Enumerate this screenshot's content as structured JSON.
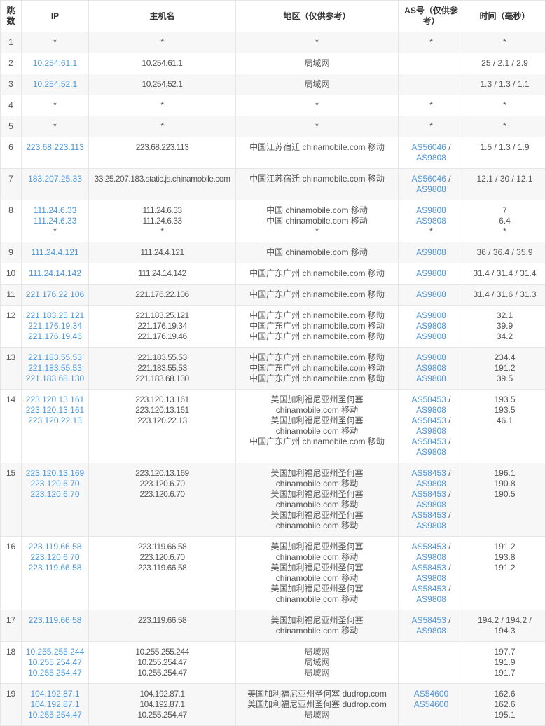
{
  "colors": {
    "link": "#4e96d8",
    "stripe": "#f7f7f7",
    "border": "#e6e6e6",
    "text": "#555555",
    "header_text": "#333333"
  },
  "table": {
    "headers": [
      "跳数",
      "IP",
      "主机名",
      "地区（仅供参考）",
      "AS号（仅供参考）",
      "时间（毫秒）"
    ],
    "rows": [
      {
        "hop": "1",
        "ip": [
          "*"
        ],
        "host": [
          "*"
        ],
        "region": [
          "*"
        ],
        "asn": [
          "*"
        ],
        "time": [
          "*"
        ]
      },
      {
        "hop": "2",
        "ip": [
          "10.254.61.1"
        ],
        "host": [
          "10.254.61.1"
        ],
        "region": [
          "局域网"
        ],
        "asn": [],
        "time": [
          "25 / 2.1 / 2.9"
        ]
      },
      {
        "hop": "3",
        "ip": [
          "10.254.52.1"
        ],
        "host": [
          "10.254.52.1"
        ],
        "region": [
          "局域网"
        ],
        "asn": [],
        "time": [
          "1.3 / 1.3 / 1.1"
        ]
      },
      {
        "hop": "4",
        "ip": [
          "*"
        ],
        "host": [
          "*"
        ],
        "region": [
          "*"
        ],
        "asn": [
          "*"
        ],
        "time": [
          "*"
        ]
      },
      {
        "hop": "5",
        "ip": [
          "*"
        ],
        "host": [
          "*"
        ],
        "region": [
          "*"
        ],
        "asn": [
          "*"
        ],
        "time": [
          "*"
        ]
      },
      {
        "hop": "6",
        "ip": [
          "223.68.223.113"
        ],
        "host": [
          "223.68.223.113"
        ],
        "region": [
          "中国江苏宿迁 chinamobile.com 移动"
        ],
        "asn": [
          [
            "AS56046",
            "AS9808"
          ]
        ],
        "time": [
          "1.5 / 1.3 / 1.9"
        ]
      },
      {
        "hop": "7",
        "ip": [
          "183.207.25.33"
        ],
        "host": [
          "33.25.207.183.static.js.chinamobile.com"
        ],
        "region": [
          "中国江苏宿迁 chinamobile.com 移动"
        ],
        "asn": [
          [
            "AS56046",
            "AS9808"
          ]
        ],
        "time": [
          "12.1 / 30 / 12.1"
        ]
      },
      {
        "hop": "8",
        "ip": [
          "111.24.6.33",
          "111.24.6.33",
          "*"
        ],
        "host": [
          "111.24.6.33",
          "111.24.6.33",
          "*"
        ],
        "region": [
          "中国 chinamobile.com 移动",
          "中国 chinamobile.com 移动",
          "*"
        ],
        "asn": [
          [
            "AS9808"
          ],
          [
            "AS9808"
          ],
          "*"
        ],
        "time": [
          "7",
          "6.4",
          "*"
        ]
      },
      {
        "hop": "9",
        "ip": [
          "111.24.4.121"
        ],
        "host": [
          "111.24.4.121"
        ],
        "region": [
          "中国 chinamobile.com 移动"
        ],
        "asn": [
          [
            "AS9808"
          ]
        ],
        "time": [
          "36 / 36.4 / 35.9"
        ]
      },
      {
        "hop": "10",
        "ip": [
          "111.24.14.142"
        ],
        "host": [
          "111.24.14.142"
        ],
        "region": [
          "中国广东广州 chinamobile.com 移动"
        ],
        "asn": [
          [
            "AS9808"
          ]
        ],
        "time": [
          "31.4 / 31.4 / 31.4"
        ]
      },
      {
        "hop": "11",
        "ip": [
          "221.176.22.106"
        ],
        "host": [
          "221.176.22.106"
        ],
        "region": [
          "中国广东广州 chinamobile.com 移动"
        ],
        "asn": [
          [
            "AS9808"
          ]
        ],
        "time": [
          "31.4 / 31.6 / 31.3"
        ]
      },
      {
        "hop": "12",
        "ip": [
          "221.183.25.121",
          "221.176.19.34",
          "221.176.19.46"
        ],
        "host": [
          "221.183.25.121",
          "221.176.19.34",
          "221.176.19.46"
        ],
        "region": [
          "中国广东广州 chinamobile.com 移动",
          "中国广东广州 chinamobile.com 移动",
          "中国广东广州 chinamobile.com 移动"
        ],
        "asn": [
          [
            "AS9808"
          ],
          [
            "AS9808"
          ],
          [
            "AS9808"
          ]
        ],
        "time": [
          "32.1",
          "39.9",
          "34.2"
        ]
      },
      {
        "hop": "13",
        "ip": [
          "221.183.55.53",
          "221.183.55.53",
          "221.183.68.130"
        ],
        "host": [
          "221.183.55.53",
          "221.183.55.53",
          "221.183.68.130"
        ],
        "region": [
          "中国广东广州 chinamobile.com 移动",
          "中国广东广州 chinamobile.com 移动",
          "中国广东广州 chinamobile.com 移动"
        ],
        "asn": [
          [
            "AS9808"
          ],
          [
            "AS9808"
          ],
          [
            "AS9808"
          ]
        ],
        "time": [
          "234.4",
          "191.2",
          "39.5"
        ]
      },
      {
        "hop": "14",
        "ip": [
          "223.120.13.161",
          "223.120.13.161",
          "223.120.22.13"
        ],
        "host": [
          "223.120.13.161",
          "223.120.13.161",
          "223.120.22.13"
        ],
        "region": [
          "美国加利福尼亚州圣何塞 chinamobile.com 移动",
          "美国加利福尼亚州圣何塞 chinamobile.com 移动",
          "中国广东广州 chinamobile.com 移动"
        ],
        "asn": [
          [
            "AS58453",
            "AS9808"
          ],
          [
            "AS58453",
            "AS9808"
          ],
          [
            "AS58453",
            "AS9808"
          ]
        ],
        "time": [
          "193.5",
          "193.5",
          "46.1"
        ]
      },
      {
        "hop": "15",
        "ip": [
          "223.120.13.169",
          "223.120.6.70",
          "223.120.6.70"
        ],
        "host": [
          "223.120.13.169",
          "223.120.6.70",
          "223.120.6.70"
        ],
        "region": [
          "美国加利福尼亚州圣何塞 chinamobile.com 移动",
          "美国加利福尼亚州圣何塞 chinamobile.com 移动",
          "美国加利福尼亚州圣何塞 chinamobile.com 移动"
        ],
        "asn": [
          [
            "AS58453",
            "AS9808"
          ],
          [
            "AS58453",
            "AS9808"
          ],
          [
            "AS58453",
            "AS9808"
          ]
        ],
        "time": [
          "196.1",
          "190.8",
          "190.5"
        ]
      },
      {
        "hop": "16",
        "ip": [
          "223.119.66.58",
          "223.120.6.70",
          "223.119.66.58"
        ],
        "host": [
          "223.119.66.58",
          "223.120.6.70",
          "223.119.66.58"
        ],
        "region": [
          "美国加利福尼亚州圣何塞 chinamobile.com 移动",
          "美国加利福尼亚州圣何塞 chinamobile.com 移动",
          "美国加利福尼亚州圣何塞 chinamobile.com 移动"
        ],
        "asn": [
          [
            "AS58453",
            "AS9808"
          ],
          [
            "AS58453",
            "AS9808"
          ],
          [
            "AS58453",
            "AS9808"
          ]
        ],
        "time": [
          "191.2",
          "193.8",
          "191.2"
        ]
      },
      {
        "hop": "17",
        "ip": [
          "223.119.66.58"
        ],
        "host": [
          "223.119.66.58"
        ],
        "region": [
          "美国加利福尼亚州圣何塞 chinamobile.com 移动"
        ],
        "asn": [
          [
            "AS58453",
            "AS9808"
          ]
        ],
        "time": [
          "194.2 / 194.2 / 194.3"
        ]
      },
      {
        "hop": "18",
        "ip": [
          "10.255.255.244",
          "10.255.254.47",
          "10.255.254.47"
        ],
        "host": [
          "10.255.255.244",
          "10.255.254.47",
          "10.255.254.47"
        ],
        "region": [
          "局域网",
          "局域网",
          "局域网"
        ],
        "asn": [],
        "time": [
          "197.7",
          "191.9",
          "191.7"
        ]
      },
      {
        "hop": "19",
        "ip": [
          "104.192.87.1",
          "104.192.87.1",
          "10.255.254.47"
        ],
        "host": [
          "104.192.87.1",
          "104.192.87.1",
          "10.255.254.47"
        ],
        "region": [
          "美国加利福尼亚州圣何塞 dudrop.com",
          "美国加利福尼亚州圣何塞 dudrop.com",
          "局域网"
        ],
        "asn": [
          [
            "AS54600"
          ],
          [
            "AS54600"
          ],
          ""
        ],
        "time": [
          "162.6",
          "162.6",
          "195.1"
        ]
      }
    ]
  }
}
